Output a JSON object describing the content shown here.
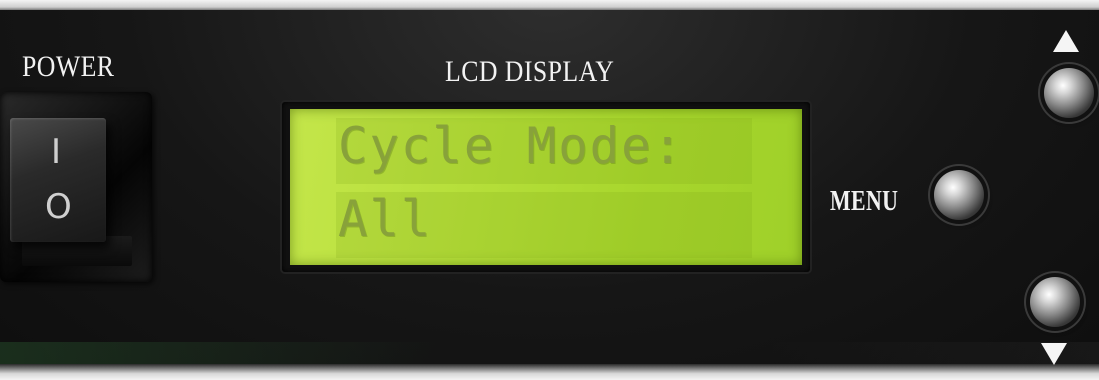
{
  "panel": {
    "power_label": "POWER",
    "lcd_label": "LCD DISPLAY",
    "menu_label": "MENU"
  },
  "power_switch": {
    "on_mark": "I",
    "off_mark": "O"
  },
  "lcd": {
    "line1": "Cycle Mode:",
    "line2": "All",
    "backlight_color": "#b6df3a",
    "text_color": "#88a23a"
  },
  "buttons": {
    "up_icon": "triangle-up-icon",
    "down_icon": "triangle-down-icon"
  }
}
